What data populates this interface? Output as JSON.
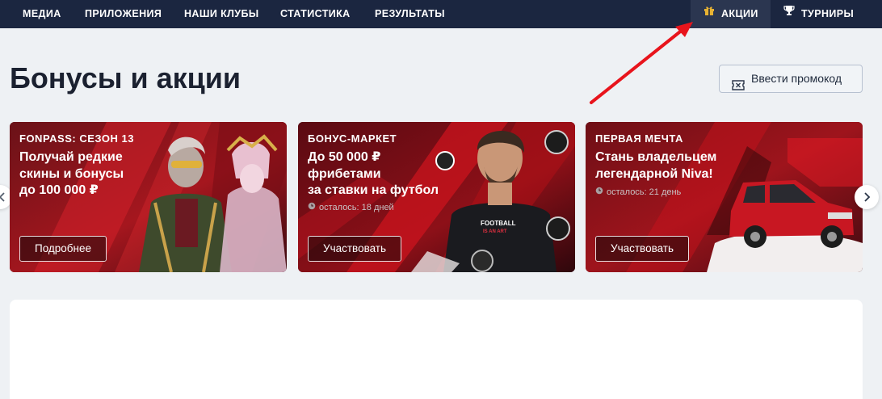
{
  "nav": {
    "items": [
      {
        "label": "МЕДИА"
      },
      {
        "label": "ПРИЛОЖЕНИЯ"
      },
      {
        "label": "НАШИ КЛУБЫ"
      },
      {
        "label": "СТАТИСТИКА"
      },
      {
        "label": "РЕЗУЛЬТАТЫ"
      }
    ],
    "promotions_label": "АКЦИИ",
    "tournaments_label": "ТУРНИРЫ"
  },
  "page": {
    "title": "Бонусы и акции",
    "promo_button_label": "Ввести промокод"
  },
  "cards": [
    {
      "tag": "FONPASS: СЕЗОН 13",
      "lines": [
        "Получай редкие",
        "скины и бонусы",
        "до 100 000 ₽"
      ],
      "button_label": "Подробнее"
    },
    {
      "tag": "БОНУС-МАРКЕТ",
      "lines": [
        "До 50 000 ₽",
        "фрибетами",
        "за ставки на футбол"
      ],
      "timer": "осталось: 18 дней",
      "button_label": "Участвовать",
      "shirt_text": [
        "FOOTBALL",
        "IS AN ART"
      ]
    },
    {
      "tag": "ПЕРВАЯ МЕЧТА",
      "lines": [
        "Стань владельцем",
        "легендарной Niva!"
      ],
      "timer": "осталось: 21 день",
      "button_label": "Участвовать"
    }
  ],
  "colors": {
    "nav_bg": "#1b2640",
    "nav_active_bg": "#2b3650",
    "brand_red": "#d0141e",
    "page_bg": "#eef1f4",
    "annotation_arrow": "#e8141c"
  },
  "icons": {
    "promotions": "gift-icon",
    "tournaments": "trophy-icon",
    "promo_button": "ticket-icon",
    "timer": "clock-icon",
    "carousel_prev": "chevron-left-icon",
    "carousel_next": "chevron-right-icon"
  }
}
